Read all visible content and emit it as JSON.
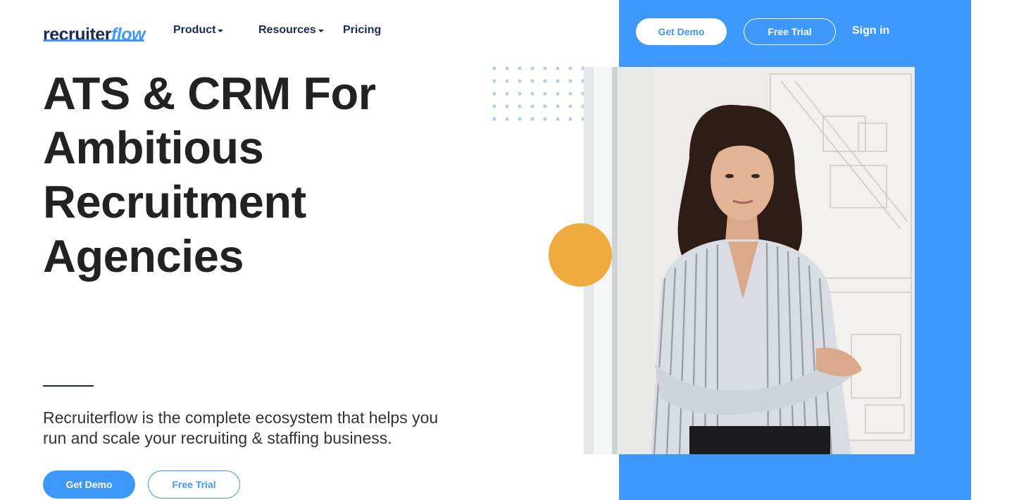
{
  "header": {
    "logo": {
      "part1": "recruiter",
      "part2": "flow"
    },
    "nav": {
      "product": "Product",
      "resources": "Resources",
      "pricing": "Pricing"
    },
    "get_demo": "Get Demo",
    "free_trial": "Free Trial",
    "sign_in": "Sign in"
  },
  "hero": {
    "headline": [
      "ATS & CRM For",
      "Ambitious",
      "Recruitment",
      "Agencies"
    ],
    "subheadline": [
      "Recruiterflow is the complete ecosystem that helps you",
      "run and scale your recruiting & staffing business."
    ],
    "get_demo": "Get Demo",
    "free_trial": "Free Trial"
  },
  "colors": {
    "brand_blue": "#3d98f9",
    "navy": "#1b2a55",
    "accent_orange": "#f0ab40"
  }
}
